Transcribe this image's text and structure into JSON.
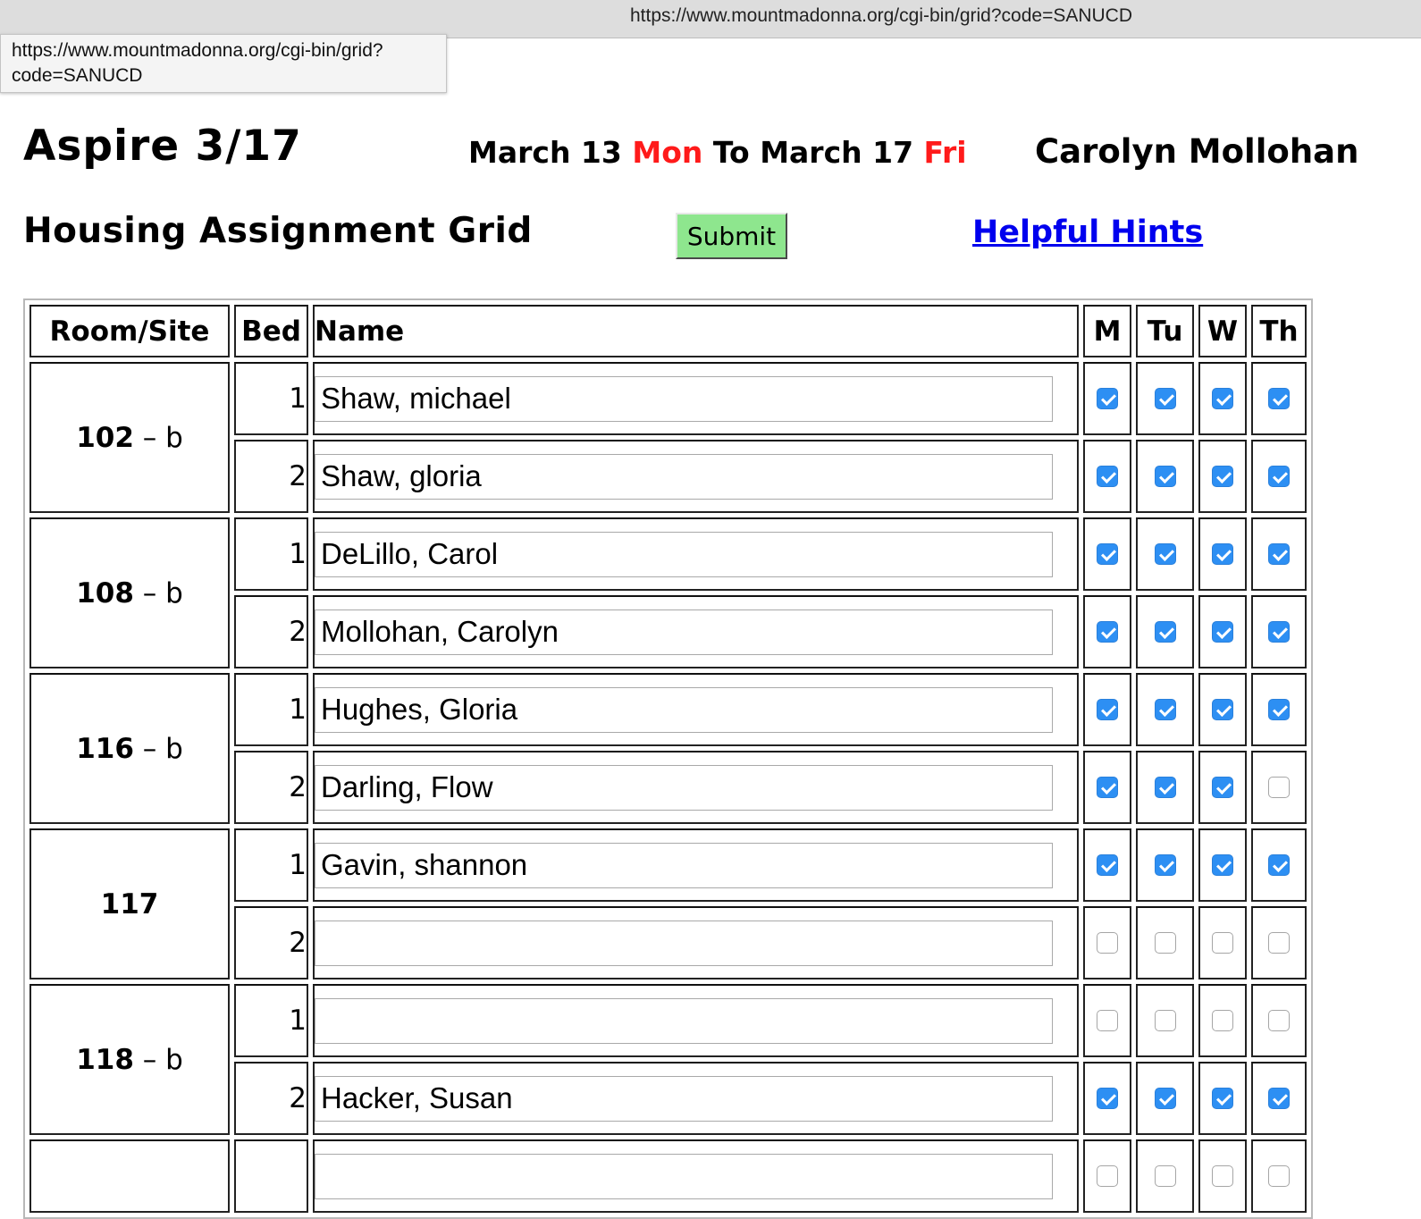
{
  "browser": {
    "url": "https://www.mountmadonna.org/cgi-bin/grid?code=SANUCD",
    "tooltip_line1": "https://www.mountmadonna.org/cgi-bin/grid?",
    "tooltip_line2": "code=SANUCD"
  },
  "header": {
    "title": "Aspire 3/17",
    "date_start": "March 13",
    "day_start": "Mon",
    "date_to": "To",
    "date_end": "March 17",
    "day_end": "Fri",
    "user_name": "Carolyn Mollohan",
    "subtitle": "Housing Assignment Grid",
    "submit_label": "Submit",
    "hints_label": "Helpful Hints"
  },
  "colors": {
    "day_highlight": "#ff1a1a",
    "submit_bg": "#8ee68e",
    "link": "#0000ee",
    "checkbox_on": "#2d8ff3"
  },
  "table": {
    "headers": {
      "room": "Room/Site",
      "bed": "Bed",
      "name": "Name",
      "days": [
        "M",
        "Tu",
        "W",
        "Th"
      ]
    },
    "rooms": [
      {
        "number": "102",
        "suffix": " – b",
        "beds": [
          {
            "bed": "1",
            "name": "Shaw, michael",
            "days": [
              true,
              true,
              true,
              true
            ]
          },
          {
            "bed": "2",
            "name": "Shaw, gloria",
            "days": [
              true,
              true,
              true,
              true
            ]
          }
        ]
      },
      {
        "number": "108",
        "suffix": " – b",
        "beds": [
          {
            "bed": "1",
            "name": "DeLillo, Carol",
            "days": [
              true,
              true,
              true,
              true
            ]
          },
          {
            "bed": "2",
            "name": "Mollohan, Carolyn",
            "days": [
              true,
              true,
              true,
              true
            ]
          }
        ]
      },
      {
        "number": "116",
        "suffix": " – b",
        "beds": [
          {
            "bed": "1",
            "name": "Hughes, Gloria",
            "days": [
              true,
              true,
              true,
              true
            ]
          },
          {
            "bed": "2",
            "name": "Darling, Flow",
            "days": [
              true,
              true,
              true,
              false
            ]
          }
        ]
      },
      {
        "number": "117",
        "suffix": "",
        "beds": [
          {
            "bed": "1",
            "name": "Gavin, shannon",
            "days": [
              true,
              true,
              true,
              true
            ]
          },
          {
            "bed": "2",
            "name": "",
            "days": [
              false,
              false,
              false,
              false
            ]
          }
        ]
      },
      {
        "number": "118",
        "suffix": " – b",
        "beds": [
          {
            "bed": "1",
            "name": "",
            "days": [
              false,
              false,
              false,
              false
            ]
          },
          {
            "bed": "2",
            "name": "Hacker, Susan",
            "days": [
              true,
              true,
              true,
              true
            ]
          }
        ]
      },
      {
        "number": "",
        "suffix": "",
        "beds": [
          {
            "bed": "",
            "name": "",
            "days": [
              false,
              false,
              false,
              false
            ]
          }
        ]
      }
    ]
  }
}
